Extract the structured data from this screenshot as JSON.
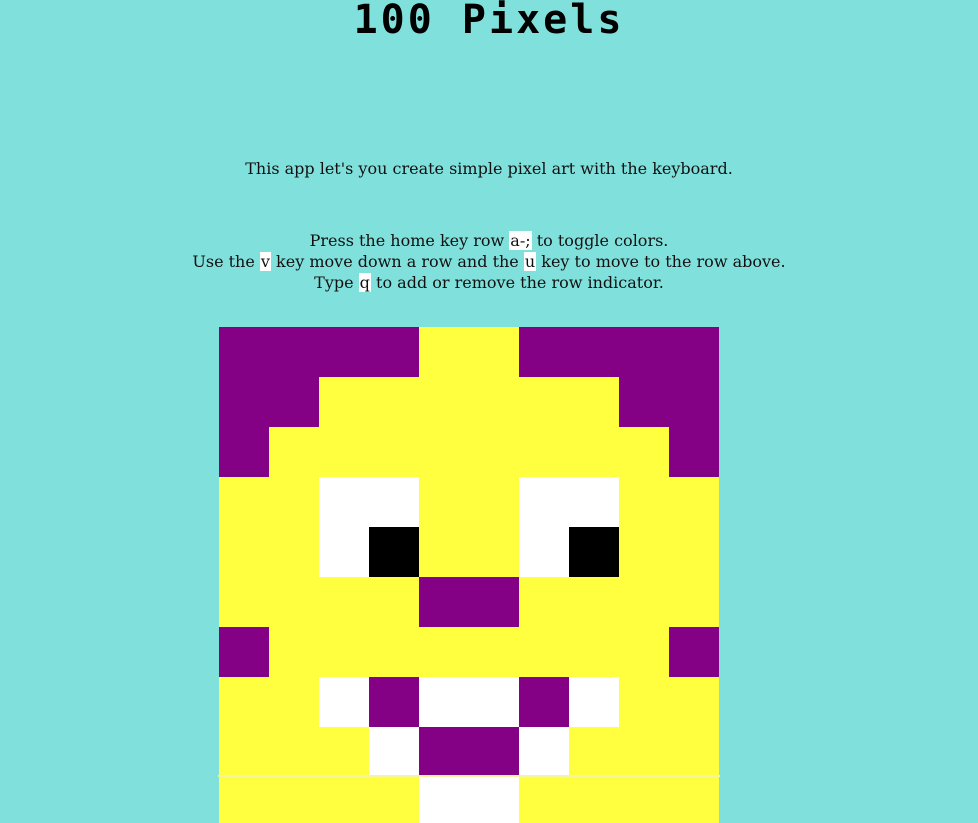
{
  "header": {
    "title": "100 Pixels"
  },
  "intro": {
    "text": "This app let's you create simple pixel art with the keyboard."
  },
  "instructions": {
    "line1": {
      "pre": "Press the home key row ",
      "key": "a-;",
      "post": " to toggle colors."
    },
    "line2": {
      "pre": "Use the ",
      "key1": "v",
      "mid": " key move down a row and the ",
      "key2": "u",
      "post": " key to move to the row above."
    },
    "line3": {
      "pre": "Type ",
      "key": "q",
      "post": " to add or remove the row indicator."
    }
  },
  "palette": {
    "P": "#840084",
    "Y": "#FFFF40",
    "W": "#FFFFFF",
    "K": "#000000"
  },
  "grid": {
    "rows": [
      [
        "P",
        "P",
        "P",
        "P",
        "Y",
        "Y",
        "P",
        "P",
        "P",
        "P"
      ],
      [
        "P",
        "P",
        "Y",
        "Y",
        "Y",
        "Y",
        "Y",
        "Y",
        "P",
        "P"
      ],
      [
        "P",
        "Y",
        "Y",
        "Y",
        "Y",
        "Y",
        "Y",
        "Y",
        "Y",
        "P"
      ],
      [
        "Y",
        "Y",
        "W",
        "W",
        "Y",
        "Y",
        "W",
        "W",
        "Y",
        "Y"
      ],
      [
        "Y",
        "Y",
        "W",
        "K",
        "Y",
        "Y",
        "W",
        "K",
        "Y",
        "Y"
      ],
      [
        "Y",
        "Y",
        "Y",
        "Y",
        "P",
        "P",
        "Y",
        "Y",
        "Y",
        "Y"
      ],
      [
        "P",
        "Y",
        "Y",
        "Y",
        "Y",
        "Y",
        "Y",
        "Y",
        "Y",
        "P"
      ],
      [
        "Y",
        "Y",
        "W",
        "P",
        "W",
        "W",
        "P",
        "W",
        "Y",
        "Y"
      ],
      [
        "Y",
        "Y",
        "Y",
        "W",
        "P",
        "P",
        "W",
        "Y",
        "Y",
        "Y"
      ],
      [
        "Y",
        "Y",
        "Y",
        "Y",
        "W",
        "W",
        "Y",
        "Y",
        "Y",
        "Y"
      ]
    ],
    "active_row": 9
  }
}
